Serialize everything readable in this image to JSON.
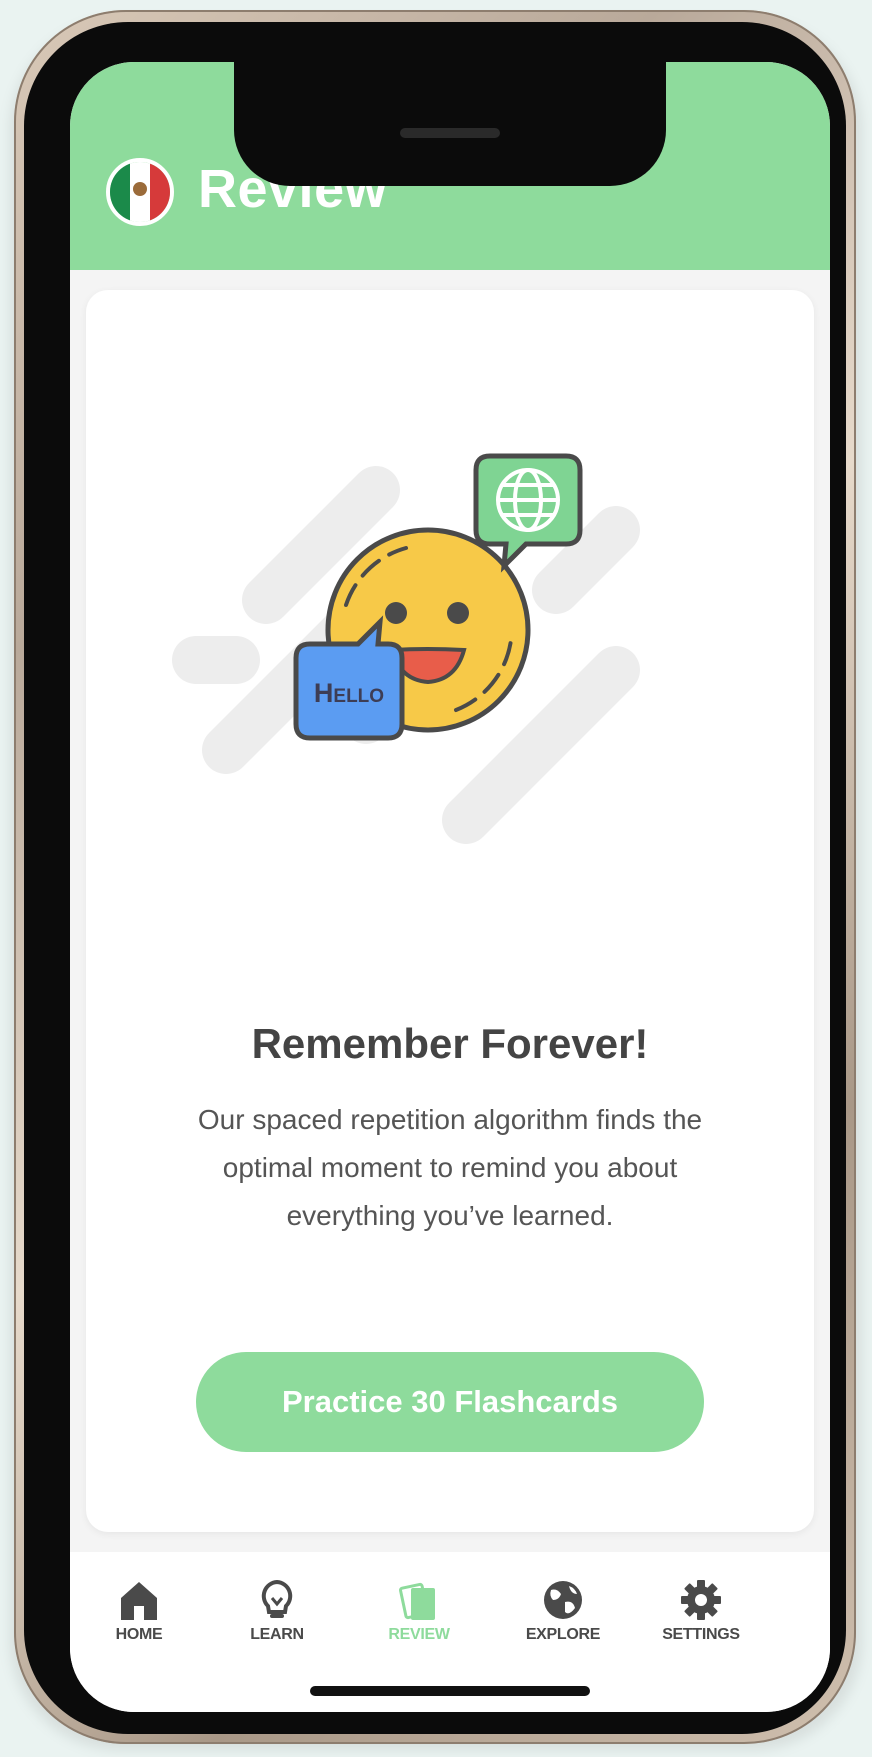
{
  "header": {
    "title": "Review",
    "flag_icon": "mexico-flag-icon",
    "background_color": "#8edb9c"
  },
  "card": {
    "illustration": {
      "hello_bubble_text": "Hello",
      "globe_icon": "globe-icon",
      "face_icon": "smiling-face-icon"
    },
    "heading": "Remember Forever!",
    "body_lines": [
      "Our spaced repetition algorithm finds the",
      "optimal moment to remind you about",
      "everything you’ve learned."
    ],
    "button_label": "Practice 30 Flashcards"
  },
  "tabbar": {
    "active_color": "#8edb9c",
    "items": [
      {
        "label": "HOME",
        "icon": "home-icon"
      },
      {
        "label": "LEARN",
        "icon": "lightbulb-icon"
      },
      {
        "label": "REVIEW",
        "icon": "flashcards-icon",
        "active": true
      },
      {
        "label": "EXPLORE",
        "icon": "globe-icon"
      },
      {
        "label": "SETTINGS",
        "icon": "gear-icon"
      }
    ]
  }
}
